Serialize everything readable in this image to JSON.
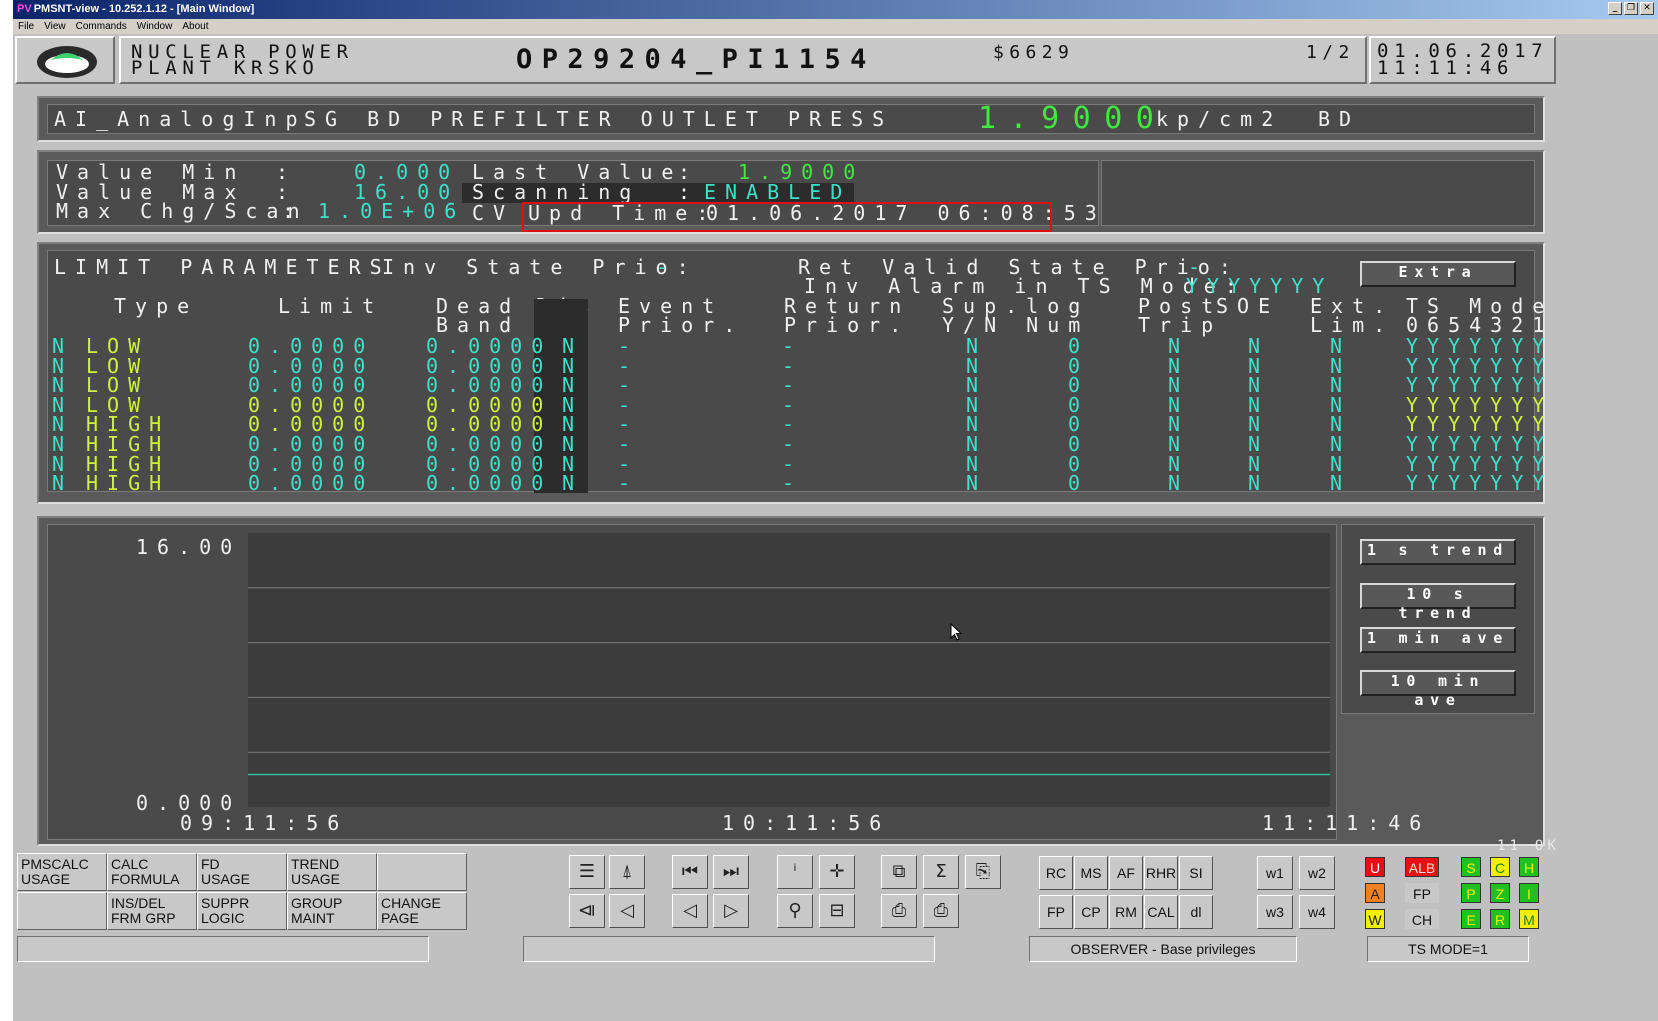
{
  "window": {
    "title": "PMSNT-view - 10.252.1.12 - [Main Window]",
    "app_badge": "PV"
  },
  "menu": [
    "File",
    "View",
    "Commands",
    "Window",
    "About"
  ],
  "header": {
    "plant_line1": "NUCLEAR POWER",
    "plant_line2": "PLANT KRSKO",
    "point_id": "OP29204_PI1154",
    "code": "$6629",
    "page": "1/2",
    "date": "01.06.2017",
    "time": "11:11:46"
  },
  "point": {
    "type": "AI_AnalogInp",
    "description": "SG BD PREFILTER OUTLET PRESS",
    "value": "1.9000",
    "unit": "kp/cm2",
    "system": "BD"
  },
  "info": {
    "value_min_label": "Value Min",
    "value_min": "0.000",
    "value_max_label": "Value Max",
    "value_max": "16.00",
    "max_chg_label": "Max Chg/Scan",
    "max_chg": "1.0E+06",
    "colon": ":",
    "last_value_label": "Last Value",
    "last_value": "1.9000",
    "scanning_label": "Scanning",
    "scanning": "ENABLED",
    "cv_label": "CV",
    "upd_time_label": "Upd Time:",
    "upd_time": "01.06.2017 06:08:53"
  },
  "limits": {
    "title": "LIMIT PARAMETERS",
    "inv_state_label": "Inv State Prio:",
    "inv_state": "-",
    "ret_valid_label": "Ret Valid State Prio:",
    "ret_valid": "-",
    "inv_alarm_label": "Inv Alarm in TS Mode:",
    "inv_alarm": "YYYYYYY",
    "extra_button": "Extra",
    "headers": [
      [
        "Type",
        ""
      ],
      [
        "Limit",
        ""
      ],
      [
        "Dead",
        "Band"
      ],
      [
        "Dis",
        "Ev."
      ],
      [
        "Event",
        "Prior."
      ],
      [
        "Return",
        "Prior."
      ],
      [
        "Sup.log",
        "Y/N Num"
      ],
      [
        "Post",
        "Trip"
      ],
      [
        "SOE",
        ""
      ],
      [
        "Ext.",
        "Lim."
      ],
      [
        "TS Mode",
        "0654321"
      ]
    ],
    "rows": [
      {
        "n": "N",
        "type": "LOW",
        "limit": "0.0000",
        "dead_band": "0.0000",
        "dis": "N",
        "event": "-",
        "return": "-",
        "sup_yn": "N",
        "sup_num": "0",
        "post": "N",
        "soe": "N",
        "ext": "N",
        "ts": "YYYYYYY"
      },
      {
        "n": "N",
        "type": "LOW",
        "limit": "0.0000",
        "dead_band": "0.0000",
        "dis": "N",
        "event": "-",
        "return": "-",
        "sup_yn": "N",
        "sup_num": "0",
        "post": "N",
        "soe": "N",
        "ext": "N",
        "ts": "YYYYYYY"
      },
      {
        "n": "N",
        "type": "LOW",
        "limit": "0.0000",
        "dead_band": "0.0000",
        "dis": "N",
        "event": "-",
        "return": "-",
        "sup_yn": "N",
        "sup_num": "0",
        "post": "N",
        "soe": "N",
        "ext": "N",
        "ts": "YYYYYYY"
      },
      {
        "n": "N",
        "type": "LOW",
        "limit": "0.0000",
        "dead_band": "0.0000",
        "dis": "N",
        "event": "-",
        "return": "-",
        "sup_yn": "N",
        "sup_num": "0",
        "post": "N",
        "soe": "N",
        "ext": "N",
        "ts": "YYYYYYY"
      },
      {
        "n": "N",
        "type": "HIGH",
        "limit": "0.0000",
        "dead_band": "0.0000",
        "dis": "N",
        "event": "-",
        "return": "-",
        "sup_yn": "N",
        "sup_num": "0",
        "post": "N",
        "soe": "N",
        "ext": "N",
        "ts": "YYYYYYY"
      },
      {
        "n": "N",
        "type": "HIGH",
        "limit": "0.0000",
        "dead_band": "0.0000",
        "dis": "N",
        "event": "-",
        "return": "-",
        "sup_yn": "N",
        "sup_num": "0",
        "post": "N",
        "soe": "N",
        "ext": "N",
        "ts": "YYYYYYY"
      },
      {
        "n": "N",
        "type": "HIGH",
        "limit": "0.0000",
        "dead_band": "0.0000",
        "dis": "N",
        "event": "-",
        "return": "-",
        "sup_yn": "N",
        "sup_num": "0",
        "post": "N",
        "soe": "N",
        "ext": "N",
        "ts": "YYYYYYY"
      },
      {
        "n": "N",
        "type": "HIGH",
        "limit": "0.0000",
        "dead_band": "0.0000",
        "dis": "N",
        "event": "-",
        "return": "-",
        "sup_yn": "N",
        "sup_num": "0",
        "post": "N",
        "soe": "N",
        "ext": "N",
        "ts": "YYYYYYY"
      }
    ]
  },
  "trend": {
    "y_max": "16.00",
    "y_min": "0.000",
    "x_labels": [
      "09:11:56",
      "10:11:56",
      "11:11:46"
    ],
    "buttons": [
      "1 s trend",
      "10 s trend",
      "1 min ave",
      "10 min ave"
    ],
    "status": "11 OK"
  },
  "chart_data": {
    "type": "line",
    "x": [
      "09:11:56",
      "10:11:56",
      "11:11:46"
    ],
    "series": [
      {
        "values": [
          1.9,
          1.9,
          1.9
        ]
      }
    ],
    "ylim": [
      0,
      16
    ],
    "ticks_y": [
      "0.000",
      "16.00"
    ],
    "grid": true,
    "line_color": "#2ec0a0"
  },
  "bottom": {
    "text_buttons": [
      [
        "PMSCALC",
        "USAGE"
      ],
      [
        "CALC",
        "FORMULA"
      ],
      [
        "FD",
        "USAGE"
      ],
      [
        "TREND",
        "USAGE"
      ],
      [
        "",
        ""
      ],
      [
        "",
        ""
      ],
      [
        "INS/DEL",
        "FRM GRP"
      ],
      [
        "SUPPR",
        "LOGIC"
      ],
      [
        "GROUP",
        "MAINT"
      ],
      [
        "CHANGE",
        "PAGE"
      ]
    ],
    "letter_buttons_row1": [
      "RC",
      "MS",
      "AF",
      "RHR",
      "SI"
    ],
    "letter_buttons_row2": [
      "FP",
      "CP",
      "RM",
      "CAL",
      "dl"
    ],
    "w_buttons": [
      "w1",
      "w2",
      "w3",
      "w4"
    ],
    "alarm_col1": [
      "U",
      "A",
      "W"
    ],
    "alarm_col2": [
      "ALB",
      "FP",
      "CH"
    ],
    "alarm_group": [
      "S",
      "C",
      "H",
      "P",
      "Z",
      "I",
      "E",
      "R",
      "M"
    ],
    "status_privileges": "OBSERVER - Base privileges",
    "status_ts_mode": "TS MODE=1"
  },
  "colors": {
    "value_cyan": "#3fe0c8",
    "value_green": "#40e840",
    "highlight_red": "#e01010",
    "alarm_red": "#e81010",
    "alarm_yellow": "#f0f000",
    "alarm_green": "#20c020"
  }
}
